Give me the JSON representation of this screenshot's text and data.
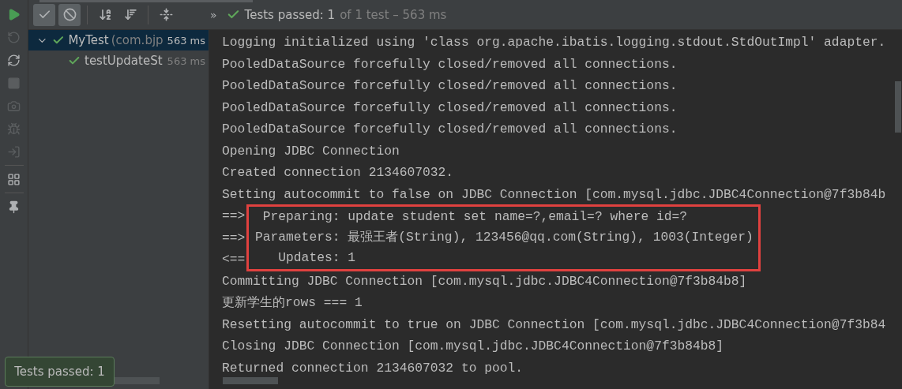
{
  "toolbar": {
    "buttons": [
      {
        "kind": "passed",
        "selected": true
      },
      {
        "kind": "ignored",
        "selected": true
      },
      {
        "kind": "sort-alpha",
        "selected": false
      },
      {
        "kind": "sort-duration",
        "selected": false
      },
      {
        "kind": "expand",
        "selected": false
      }
    ],
    "more": "»",
    "status": {
      "label": "Tests passed: 1",
      "detail": "of 1 test – 563 ms"
    }
  },
  "side_tools": [
    {
      "kind": "run",
      "disabled": false
    },
    {
      "kind": "rerun-failed",
      "disabled": true
    },
    {
      "kind": "auto-test",
      "disabled": false
    },
    {
      "kind": "stop",
      "disabled": true
    },
    {
      "kind": "snapshot",
      "disabled": true
    },
    {
      "kind": "debug",
      "disabled": true
    },
    {
      "kind": "import",
      "disabled": true
    },
    {
      "kind": "layout",
      "disabled": false
    },
    {
      "kind": "pin",
      "disabled": false
    }
  ],
  "tree": [
    {
      "name": "MyTest",
      "package": "(com.bjp",
      "time": "563 ms",
      "expanded": true,
      "selected": true,
      "passed": true,
      "children": [
        {
          "name": "testUpdateSt",
          "time": "563 ms",
          "selected": false,
          "passed": true
        }
      ]
    }
  ],
  "console": {
    "lines_before": [
      "Logging initialized using 'class org.apache.ibatis.logging.stdout.StdOutImpl' adapter.",
      "PooledDataSource forcefully closed/removed all connections.",
      "PooledDataSource forcefully closed/removed all connections.",
      "PooledDataSource forcefully closed/removed all connections.",
      "PooledDataSource forcefully closed/removed all connections.",
      "Opening JDBC Connection",
      "Created connection 2134607032.",
      "Setting autocommit to false on JDBC Connection [com.mysql.jdbc.JDBC4Connection@7f3b84b"
    ],
    "highlight": [
      {
        "prefix": "==>",
        "text": " Preparing: update student set name=?,email=? where id=?"
      },
      {
        "prefix": "==>",
        "text": "Parameters: 最强王者(String), 123456@qq.com(String), 1003(Integer)"
      },
      {
        "prefix": "<==",
        "text": "   Updates: 1"
      }
    ],
    "lines_after": [
      "Committing JDBC Connection [com.mysql.jdbc.JDBC4Connection@7f3b84b8]",
      "更新学生的rows === 1",
      "Resetting autocommit to true on JDBC Connection [com.mysql.jdbc.JDBC4Connection@7f3b84",
      "Closing JDBC Connection [com.mysql.jdbc.JDBC4Connection@7f3b84b8]",
      "Returned connection 2134607032 to pool."
    ]
  },
  "toast": {
    "text": "Tests passed: 1"
  }
}
